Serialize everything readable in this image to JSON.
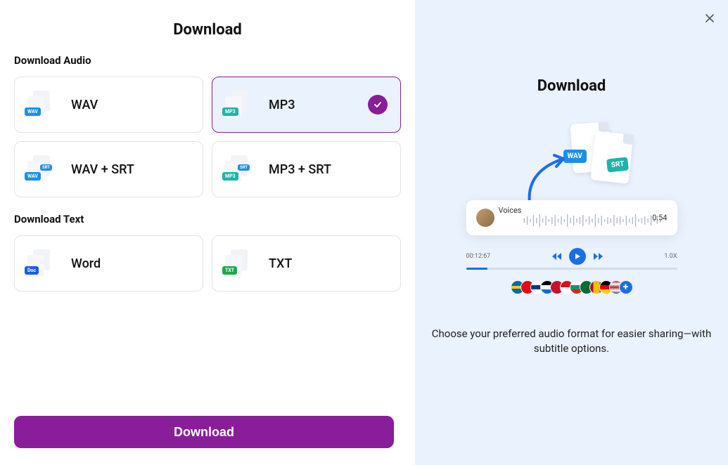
{
  "title": "Download",
  "sections": {
    "audio_label": "Download Audio",
    "text_label": "Download Text"
  },
  "options": {
    "wav": "WAV",
    "mp3": "MP3",
    "wav_srt": "WAV + SRT",
    "mp3_srt": "MP3 + SRT",
    "word": "Word",
    "txt": "TXT"
  },
  "selected": "mp3",
  "download_button": "Download",
  "right": {
    "title": "Download",
    "voices_label": "Voices",
    "duration": "0:54",
    "timestamp": "00:12:67",
    "speed": "1.0X",
    "description": "Choose your preferred audio format for easier sharing—with subtitle options.",
    "badge_wav": "WAV",
    "badge_srt": "SRT"
  }
}
